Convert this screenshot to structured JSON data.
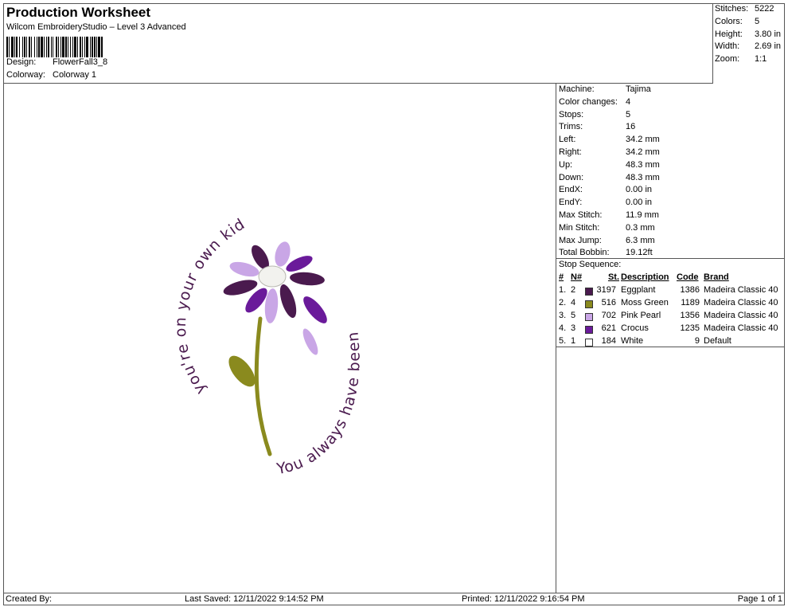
{
  "header": {
    "title": "Production Worksheet",
    "subtitle": "Wilcom EmbroideryStudio – Level 3 Advanced",
    "design_label": "Design:",
    "design_value": "FlowerFall3_8",
    "colorway_label": "Colorway:",
    "colorway_value": "Colorway 1"
  },
  "summary": {
    "stitches_label": "Stitches:",
    "stitches": "5222",
    "colors_label": "Colors:",
    "colors": "5",
    "height_label": "Height:",
    "height": "3.80 in",
    "width_label": "Width:",
    "width": "2.69 in",
    "zoom_label": "Zoom:",
    "zoom": "1:1"
  },
  "details": [
    {
      "label": "Machine:",
      "value": "Tajima"
    },
    {
      "label": "Color changes:",
      "value": "4"
    },
    {
      "label": "Stops:",
      "value": "5"
    },
    {
      "label": "Trims:",
      "value": "16"
    },
    {
      "label": "Left:",
      "value": "34.2 mm"
    },
    {
      "label": "Right:",
      "value": "34.2 mm"
    },
    {
      "label": "Up:",
      "value": "48.3 mm"
    },
    {
      "label": "Down:",
      "value": "48.3 mm"
    },
    {
      "label": "EndX:",
      "value": "0.00 in"
    },
    {
      "label": "EndY:",
      "value": "0.00 in"
    },
    {
      "label": "Max Stitch:",
      "value": "11.9 mm"
    },
    {
      "label": "Min Stitch:",
      "value": "0.3 mm"
    },
    {
      "label": "Max Jump:",
      "value": "6.3 mm"
    },
    {
      "label": "Total Bobbin:",
      "value": "19.12ft"
    }
  ],
  "stop_sequence": {
    "title": "Stop Sequence:",
    "headers": {
      "num": "#",
      "n": "N#",
      "st": "St.",
      "desc": "Description",
      "code": "Code",
      "brand": "Brand"
    },
    "rows": [
      {
        "num": "1.",
        "n": "2",
        "color": "#4a1a4e",
        "st": "3197",
        "desc": "Eggplant",
        "code": "1386",
        "brand": "Madeira Classic 40"
      },
      {
        "num": "2.",
        "n": "4",
        "color": "#8a8a1e",
        "st": "516",
        "desc": "Moss Green",
        "code": "1189",
        "brand": "Madeira Classic 40"
      },
      {
        "num": "3.",
        "n": "5",
        "color": "#c9a6e6",
        "st": "702",
        "desc": "Pink Pearl",
        "code": "1356",
        "brand": "Madeira Classic 40"
      },
      {
        "num": "4.",
        "n": "3",
        "color": "#6a1a9a",
        "st": "621",
        "desc": "Crocus",
        "code": "1235",
        "brand": "Madeira Classic 40"
      },
      {
        "num": "5.",
        "n": "1",
        "color": "#ffffff",
        "st": "184",
        "desc": "White",
        "code": "9",
        "brand": "Default"
      }
    ]
  },
  "design_text": {
    "top": "you're on your own kid",
    "bottom": "You always have been"
  },
  "colors": {
    "eggplant": "#4a1a4e",
    "moss_green": "#8a8a1e",
    "pink_pearl": "#c9a6e6",
    "crocus": "#6a1a9a",
    "white": "#f2f2ee"
  },
  "footer": {
    "created_by": "Created By:",
    "last_saved": "Last Saved: 12/11/2022 9:14:52 PM",
    "printed": "Printed: 12/11/2022 9:16:54 PM",
    "page": "Page 1 of 1"
  }
}
